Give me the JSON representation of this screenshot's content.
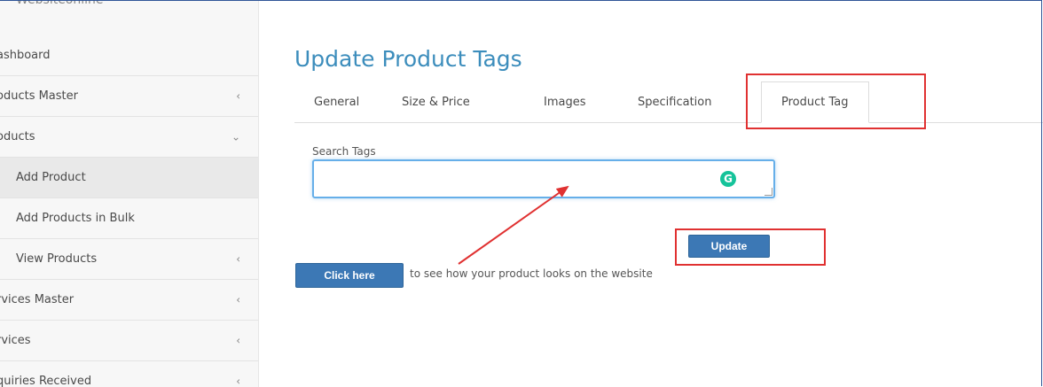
{
  "sidebar": {
    "brand": "Websiteonline",
    "items": [
      {
        "label": "ashboard",
        "chevron": ""
      },
      {
        "label": "oducts Master",
        "chevron": "‹"
      },
      {
        "label": "oducts",
        "chevron": "⌄"
      },
      {
        "label": "Add Product",
        "chevron": ""
      },
      {
        "label": "Add Products in Bulk",
        "chevron": ""
      },
      {
        "label": "View Products",
        "chevron": "‹"
      },
      {
        "label": "rvices Master",
        "chevron": "‹"
      },
      {
        "label": "rvices",
        "chevron": "‹"
      },
      {
        "label": "quiries Received",
        "chevron": "‹"
      }
    ]
  },
  "main": {
    "title": "Update Product Tags",
    "tabs": [
      {
        "label": "General"
      },
      {
        "label": "Size & Price"
      },
      {
        "label": "Images"
      },
      {
        "label": "Specification"
      },
      {
        "label": "Product Tag"
      }
    ],
    "search_label": "Search Tags",
    "search_value": "",
    "update_button": "Update",
    "click_here_button": "Click here",
    "helper_text": "to see how your product looks on the website"
  },
  "colors": {
    "accent": "#3c8dbc",
    "button": "#3c78b5",
    "highlight": "#e03131",
    "grammarly": "#15c39a"
  },
  "icons": {
    "grammarly": "grammarly-icon",
    "annotation": "red-arrow-annotation"
  }
}
